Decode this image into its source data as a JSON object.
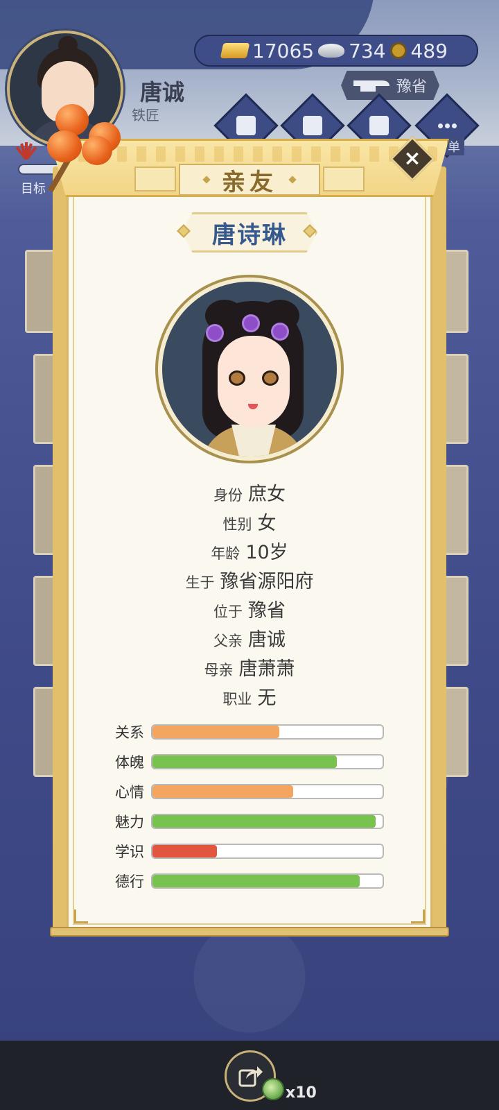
{
  "hud": {
    "player_name": "唐诚",
    "player_job": "铁匠",
    "gold": "17065",
    "silver": "734",
    "copper": "489",
    "region_label": "豫省",
    "menu_partial_label": "单",
    "target_label": "目标"
  },
  "dialog": {
    "title": "亲友",
    "close_symbol": "×",
    "person_name": "唐诗琳",
    "info": [
      {
        "key": "身份",
        "value": "庶女"
      },
      {
        "key": "性别",
        "value": "女"
      },
      {
        "key": "年龄",
        "value": "10岁"
      },
      {
        "key": "生于",
        "value": "豫省源阳府"
      },
      {
        "key": "位于",
        "value": "豫省"
      },
      {
        "key": "父亲",
        "value": "唐诚"
      },
      {
        "key": "母亲",
        "value": "唐萧萧"
      },
      {
        "key": "职业",
        "value": "无"
      }
    ],
    "stats": [
      {
        "label": "关系",
        "fraction": 0.55,
        "color": "#f4a660"
      },
      {
        "label": "体魄",
        "fraction": 0.8,
        "color": "#78c24f"
      },
      {
        "label": "心情",
        "fraction": 0.61,
        "color": "#f4a660"
      },
      {
        "label": "魅力",
        "fraction": 0.97,
        "color": "#78c24f"
      },
      {
        "label": "学识",
        "fraction": 0.28,
        "color": "#e2553f"
      },
      {
        "label": "德行",
        "fraction": 0.9,
        "color": "#78c24f"
      }
    ]
  },
  "bottom": {
    "share_count": "x10"
  }
}
